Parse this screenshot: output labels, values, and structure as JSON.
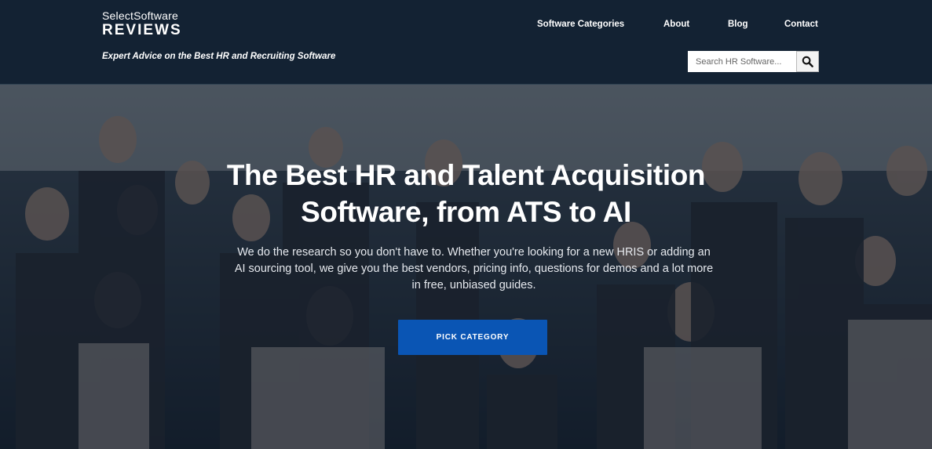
{
  "header": {
    "logo_top": "SelectSoftware",
    "logo_bottom": "REVIEWS",
    "tagline": "Expert Advice on the Best HR and Recruiting Software",
    "nav": {
      "software_categories": "Software Categories",
      "about": "About",
      "blog": "Blog",
      "contact": "Contact"
    },
    "search": {
      "placeholder": "Search HR Software...",
      "value": "",
      "icon": "search-icon"
    }
  },
  "hero": {
    "title_line1": "The Best HR and Talent Acquisition",
    "title_line2": "Software, from ATS to AI",
    "subtitle_line1": "We do the research so you don't have to. Whether you're looking for a new HRIS or adding an",
    "subtitle_line2": "AI sourcing tool, we give you the best vendors, pricing info, questions for demos and a lot more",
    "subtitle_line3": "in free, unbiased guides.",
    "cta_label": "PICK CATEGORY",
    "background": "team-group-photo"
  },
  "colors": {
    "header_bg": "#132233",
    "cta_bg": "#0a55b4",
    "text": "#ffffff"
  }
}
